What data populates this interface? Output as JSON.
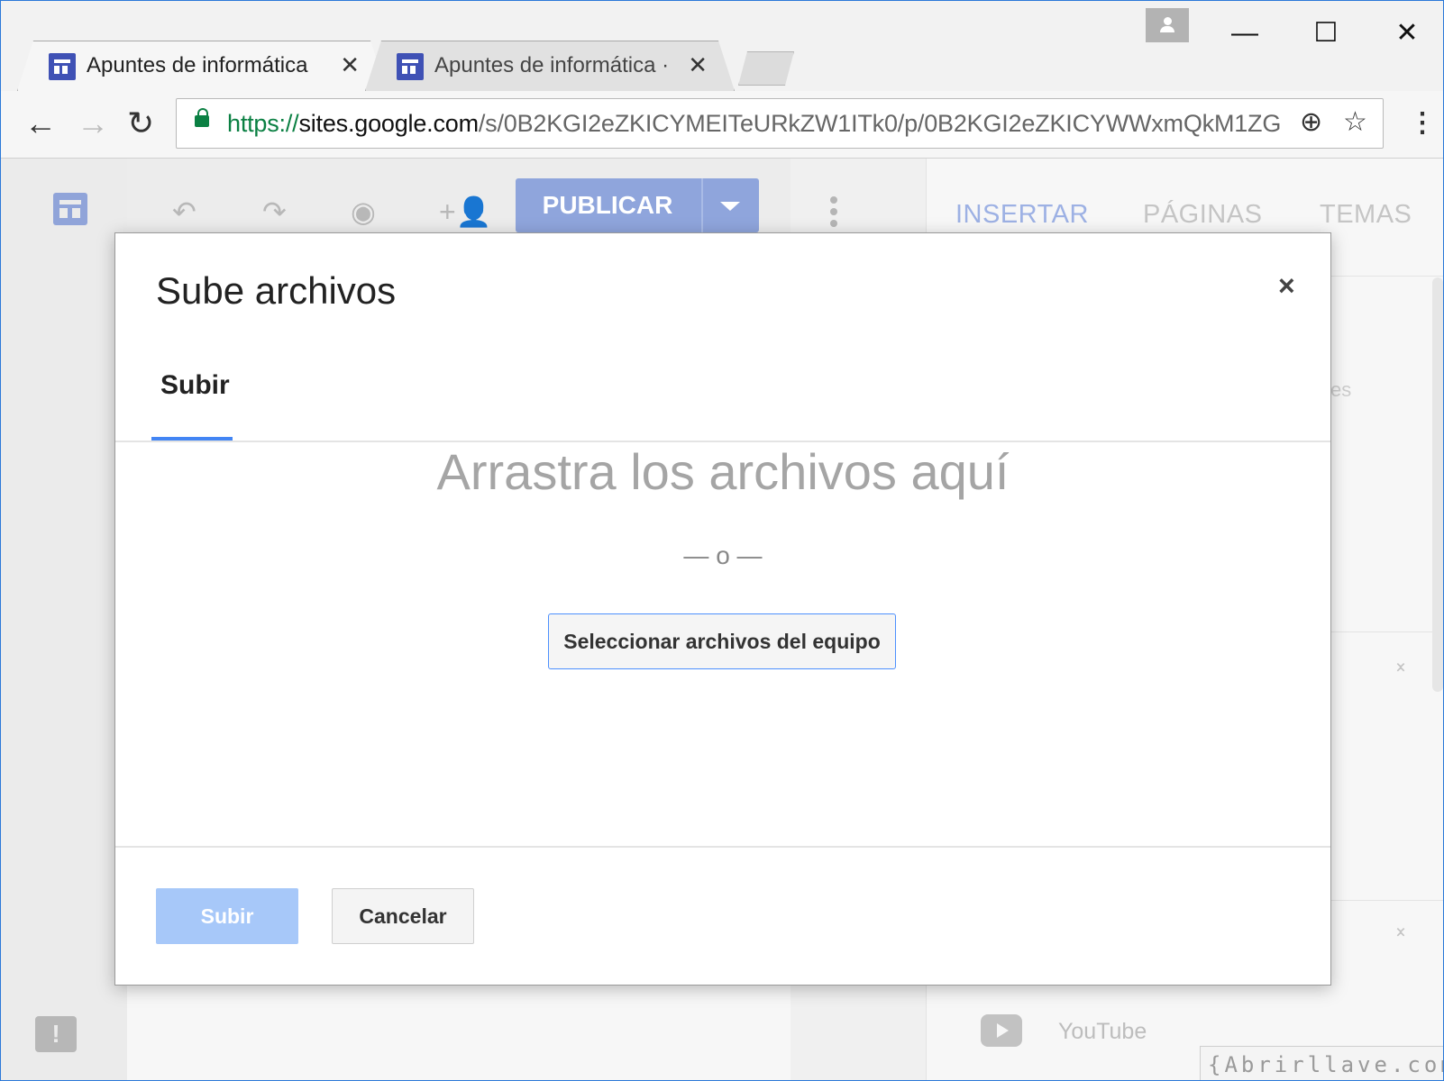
{
  "browser": {
    "tabs": [
      {
        "title": "Apuntes de informática",
        "close": "✕"
      },
      {
        "title": "Apuntes de informática ·",
        "close": "✕"
      }
    ],
    "window_controls": {
      "minimize": "—",
      "maximize": "☐",
      "close": "✕"
    },
    "url": {
      "scheme": "https://",
      "host": "sites.google.com",
      "path": "/s/0B2KGI2eZKICYMEITeURkZW1ITk0/p/0B2KGI2eZKICYWWxmQkM1ZG"
    },
    "icons": {
      "back": "back-arrow-icon",
      "forward": "forward-arrow-icon",
      "reload": "reload-icon",
      "lock": "lock-icon",
      "zoom": "zoom-icon",
      "bookmark": "star-icon",
      "menu": "kebab-menu-icon"
    }
  },
  "editor": {
    "toolbar": {
      "publish_label": "PUBLICAR"
    },
    "panel_tabs": [
      "INSERTAR",
      "PÁGINAS",
      "TEMAS"
    ],
    "panel_partial_text": "es",
    "youtube_label": "YouTube"
  },
  "dialog": {
    "title": "Sube archivos",
    "close": "×",
    "tab_label": "Subir",
    "drop_text": "Arrastra los archivos aquí",
    "or_text": "— o —",
    "select_button": "Seleccionar archivos del equipo",
    "upload_button": "Subir",
    "cancel_button": "Cancelar"
  },
  "watermark": "{Abrirllave.com",
  "colors": {
    "accent": "#4285f4",
    "publish": "#8fa5dc",
    "upload_disabled": "#a7c8f9",
    "lock": "#0b8043"
  }
}
